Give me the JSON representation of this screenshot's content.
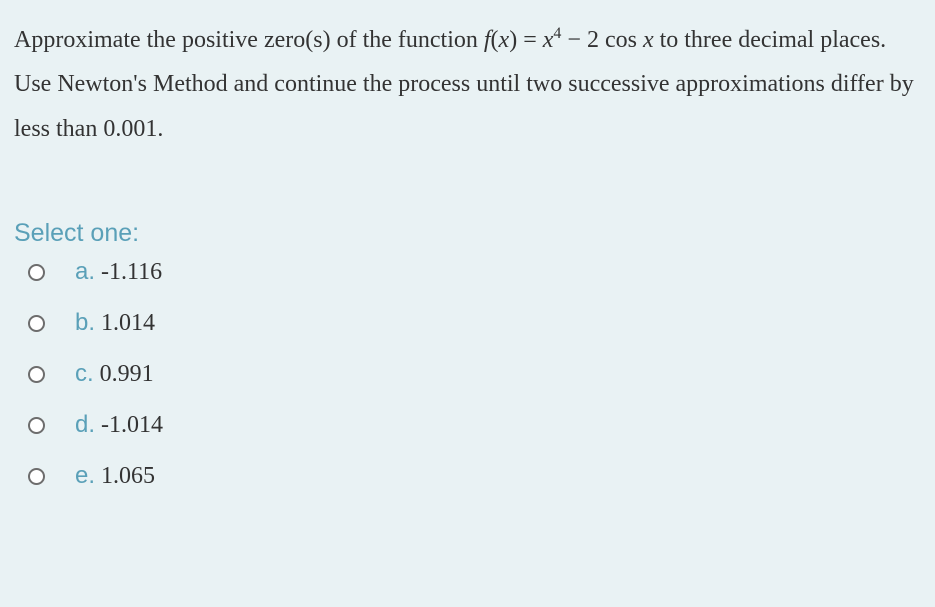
{
  "question": {
    "part1": "Approximate the positive zero(s) of the function ",
    "formula_fx": "f",
    "formula_open": "(",
    "formula_x": "x",
    "formula_close": ")",
    "formula_eq": " = ",
    "formula_x2": "x",
    "formula_sup": "4",
    "formula_minus": " − 2 cos ",
    "formula_x3": "x",
    "part2": " to three decimal places. Use Newton's Method and continue the process until two successive approximations differ by less than 0.001."
  },
  "prompt": "Select one:",
  "options": [
    {
      "letter": "a.",
      "value": " -1.116"
    },
    {
      "letter": "b.",
      "value": " 1.014"
    },
    {
      "letter": "c.",
      "value": " 0.991"
    },
    {
      "letter": "d.",
      "value": " -1.014"
    },
    {
      "letter": "e.",
      "value": " 1.065"
    }
  ]
}
